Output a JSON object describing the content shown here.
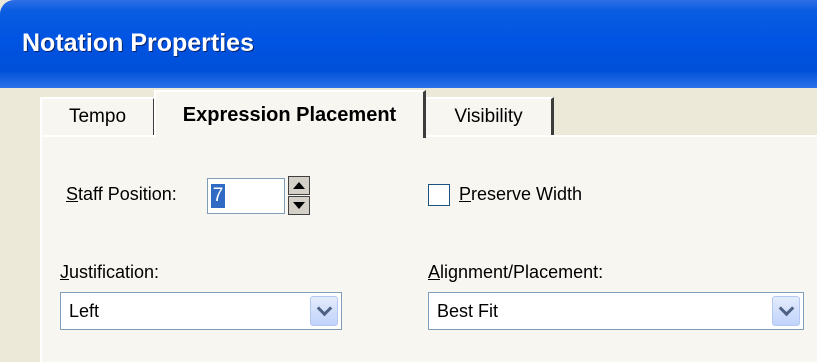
{
  "window": {
    "title": "Notation Properties"
  },
  "tabs": [
    {
      "label": "Tempo",
      "active": false
    },
    {
      "label": "Expression Placement",
      "active": true
    },
    {
      "label": "Visibility",
      "active": false
    }
  ],
  "staff_position": {
    "label_prefix": "S",
    "label_rest": "taff Position:",
    "value": "7"
  },
  "preserve_width": {
    "label_prefix": "P",
    "label_rest": "reserve Width",
    "checked": false
  },
  "justification": {
    "label_prefix": "J",
    "label_rest": "ustification:",
    "selected": "Left"
  },
  "alignment": {
    "label_prefix": "A",
    "label_rest": "lignment/Placement:",
    "selected": "Best Fit"
  },
  "icons": {
    "spin_up": "triangle-up-icon",
    "spin_down": "triangle-down-icon",
    "dropdown": "chevron-down-icon"
  },
  "colors": {
    "titlebar": "#0054e3",
    "dialog_bg": "#ece9d8",
    "selection": "#316ac5"
  }
}
